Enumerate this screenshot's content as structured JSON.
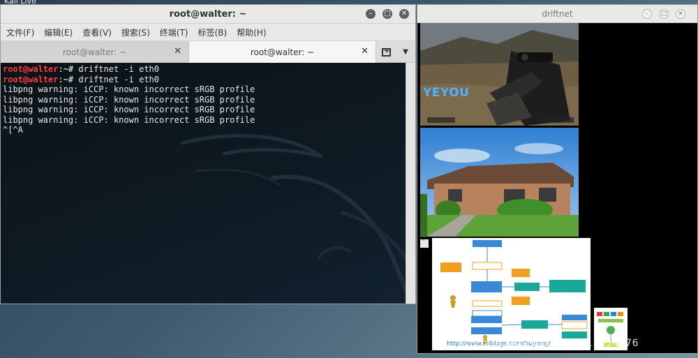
{
  "desktop": {
    "label": "Kali Live"
  },
  "terminal": {
    "title": "root@walter: ~",
    "menu": [
      "文件(F)",
      "编辑(E)",
      "查看(V)",
      "搜索(S)",
      "终端(T)",
      "标签(B)",
      "帮助(H)"
    ],
    "tabs": [
      {
        "label": "root@walter: ~",
        "active": false
      },
      {
        "label": "root@walter: ~",
        "active": true
      }
    ],
    "prompt_user": "root@walter",
    "prompt_path": ":~#",
    "commands": [
      " driftnet -i eth0",
      " driftnet -i eth0"
    ],
    "output": [
      "libpng warning: iCCP: known incorrect sRGB profile",
      "libpng warning: iCCP: known incorrect sRGB profile",
      "libpng warning: iCCP: known incorrect sRGB profile",
      "libpng warning: iCCP: known incorrect sRGB profile",
      "^[^A"
    ]
  },
  "driftnet": {
    "title": "driftnet",
    "images": [
      {
        "name": "game-screenshot-image",
        "overlay_text": "YEYOU"
      },
      {
        "name": "house-photo-image"
      },
      {
        "name": "flowchart-image",
        "caption": "http://www.cnblogs.com/huyong/"
      },
      {
        "name": "small-diagram-image"
      }
    ]
  },
  "watermark": "http://blog.csdn.net/u011554976",
  "colors": {
    "prompt_user": "#ff3b3b",
    "terminal_bg": "#0e1a22",
    "chrome": "#e8e8e7"
  }
}
